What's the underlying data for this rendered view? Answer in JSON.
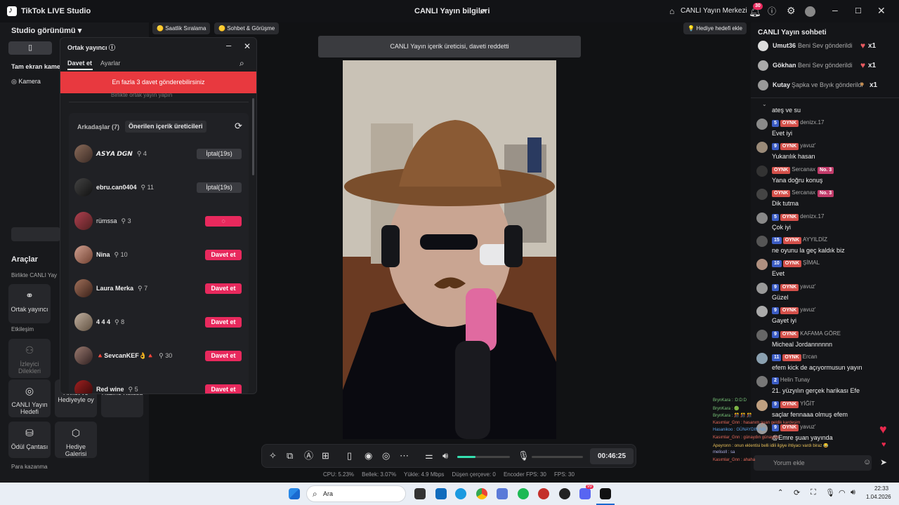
{
  "app": {
    "name": "TikTok LIVE Studio",
    "live_info": "CANLI Yayın bilgileri",
    "live_center": "CANLI Yayın Merkezi",
    "notif_count": "30"
  },
  "top_chips": {
    "hourly": "Saatlik Sıralama",
    "chat_meet": "Sohbet & Görüşme",
    "gift_goal": "Hediye hedefi ekle"
  },
  "left": {
    "studio_view": "Studio görünümü",
    "fullscreen": "Tam ekran kame",
    "camera": "Kamera",
    "tools_title": "Araçlar",
    "together_live": "Birlikte CANLI Yay",
    "cohost": "Ortak yayıncı",
    "engagement": "Etkileşim",
    "viewer_requests": "İzleyici Dilekleri",
    "live_goal": "CANLI Yayın Hedefi",
    "poll": "Anket ve Hediyeyle oy",
    "treasure": "Hazine Kutusu",
    "reward_bag": "Ödül Çantası",
    "gift_gallery": "Hediye Galerisi",
    "earn": "Para kazanma"
  },
  "popup": {
    "title": "Ortak yayıncı",
    "tab_invite": "Davet et",
    "tab_settings": "Ayarlar",
    "alert": "En fazla 3 davet gönderebilirsiniz",
    "hint": "Birlikte ortak yayın yapın",
    "friends": "Arkadaşlar (7)",
    "suggested": "Önerilen içerik üreticileri",
    "users": [
      {
        "name": "𝘼𝙎𝙔𝘼 𝘿𝙂𝙉",
        "count": "4",
        "action": "İptal(19s)",
        "kind": "cancel"
      },
      {
        "name": "ebru.can0404",
        "count": "11",
        "action": "İptal(19s)",
        "kind": "cancel"
      },
      {
        "name": "rümssa",
        "count": "3",
        "action": "",
        "kind": "invite"
      },
      {
        "name": "Nina",
        "count": "10",
        "action": "Davet et",
        "kind": "invite"
      },
      {
        "name": "Laura Merka",
        "count": "7",
        "action": "Davet et",
        "kind": "invite"
      },
      {
        "name": "4 4 4",
        "count": "8",
        "action": "Davet et",
        "kind": "invite"
      },
      {
        "name": "🔺SevcanKEF👌🔺",
        "count": "30",
        "action": "Davet et",
        "kind": "invite"
      },
      {
        "name": "Red wine",
        "count": "5",
        "action": "Davet et",
        "kind": "invite"
      }
    ]
  },
  "banner": "CANLI Yayın içerik üreticisi, daveti reddetti",
  "controls": {
    "timer": "00:46:25",
    "volume_level": 0.35
  },
  "stats": {
    "cpu": "CPU: 5.23%",
    "memory": "Bellek: 3.07%",
    "upload": "Yükle: 4.9 Mbps",
    "dropped": "Düşen çerçeve: 0",
    "encoder_fps": "Encoder FPS: 30",
    "fps": "FPS: 30"
  },
  "chat": {
    "title": "CANLI Yayın sohbeti",
    "gifts": [
      {
        "user": "Umut36",
        "text": "Beni Sev gönderildi",
        "qty": "x1"
      },
      {
        "user": "Gökhan",
        "text": "Beni Sev gönderildi",
        "qty": "x1"
      },
      {
        "user": "Kutay",
        "text": "Şapka ve Bıyık gönderildi",
        "qty": "x1"
      }
    ],
    "messages": [
      {
        "lvl": "",
        "oynk": "",
        "user": "",
        "no": "",
        "text": "ateş ve su"
      },
      {
        "lvl": "5",
        "oynk": "OYNK",
        "user": "denizx.17",
        "no": "",
        "text": "Evet iyi"
      },
      {
        "lvl": "9",
        "oynk": "OYNK",
        "user": "yavuz'",
        "no": "",
        "text": "Yukarılık hasan"
      },
      {
        "lvl": "",
        "oynk": "OYNK",
        "user": "Sercanax",
        "no": "No. 3",
        "text": "Yana doğru konuş"
      },
      {
        "lvl": "",
        "oynk": "OYNK",
        "user": "Sercanax",
        "no": "No. 3",
        "text": "Dik tutma"
      },
      {
        "lvl": "5",
        "oynk": "OYNK",
        "user": "denizx.17",
        "no": "",
        "text": "Çok iyi"
      },
      {
        "lvl": "15",
        "oynk": "OYNK",
        "user": "AYYILDİZ",
        "no": "",
        "text": "ne oyunu la geç kaldık biz"
      },
      {
        "lvl": "10",
        "oynk": "OYNK",
        "user": "ŞİMAL",
        "no": "",
        "text": "Evet"
      },
      {
        "lvl": "9",
        "oynk": "OYNK",
        "user": "yavuz'",
        "no": "",
        "text": "Güzel"
      },
      {
        "lvl": "9",
        "oynk": "OYNK",
        "user": "yavuz'",
        "no": "",
        "text": "Gayet iyi"
      },
      {
        "lvl": "9",
        "oynk": "OYNK",
        "user": "KAFAMA GÖRE",
        "no": "",
        "text": "Micheal Jordannnnnn"
      },
      {
        "lvl": "11",
        "oynk": "OYNK",
        "user": "Ercan",
        "no": "",
        "text": "efem kick de açıyormusun yayın"
      },
      {
        "lvl": "2",
        "oynk": "",
        "user": "Helin Tunay",
        "no": "",
        "text": "21. yüzyılın gerçek harikası Efe"
      },
      {
        "lvl": "9",
        "oynk": "OYNK",
        "user": "YİĞİT",
        "no": "",
        "text": "saçlar fennaaa olmuş efem"
      },
      {
        "lvl": "9",
        "oynk": "OYNK",
        "user": "yavuz'",
        "no": "",
        "text": "@Emre şuan yayında"
      }
    ],
    "input_placeholder": "Yorum ekle"
  },
  "overlay_chat": [
    "BrynKara : :D:D:D",
    "BrynKara : 🟢",
    "BrynKara : 🎊 🎊 🎊",
    "Kasımlar_Gnn : hasanım şuan geldik kardeşim",
    "Hasanikoo : GÜNAYDIN ABİ",
    "Kasımlar_Gnn : günaydın günaydın",
    "Apeyronn : onun eklentisi belli idili ilgiye ihtiyacı vardı biraz 😂",
    "melisoll : sa",
    "Kasımlar_Gnn : ahaha"
  ],
  "taskbar": {
    "search": "Ara",
    "time": "22:33",
    "date": "1.04.2026",
    "discord_badge": "99"
  },
  "colors": {
    "accent_pink": "#e8295d",
    "alert_red": "#e8393f",
    "background": "#111214"
  }
}
